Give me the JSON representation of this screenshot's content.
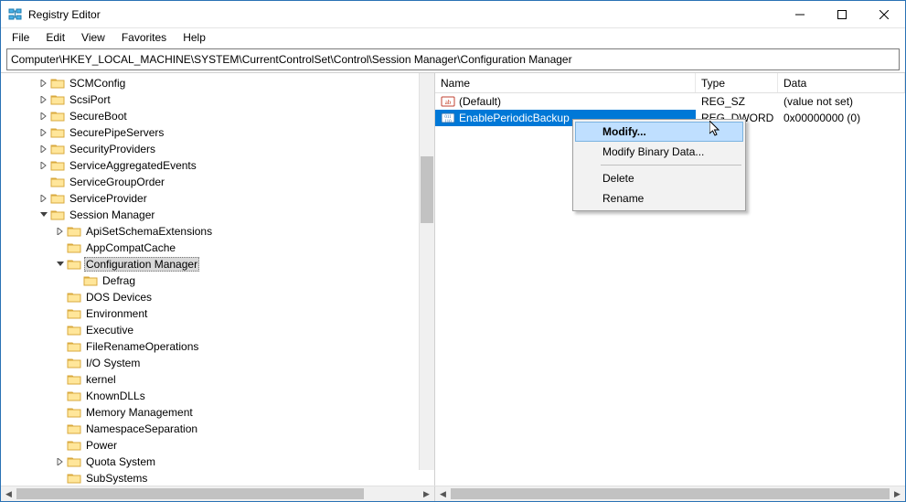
{
  "window": {
    "title": "Registry Editor"
  },
  "menu": {
    "file": "File",
    "edit": "Edit",
    "view": "View",
    "favorites": "Favorites",
    "help": "Help"
  },
  "addressbar": {
    "path": "Computer\\HKEY_LOCAL_MACHINE\\SYSTEM\\CurrentControlSet\\Control\\Session Manager\\Configuration Manager"
  },
  "tree": {
    "items": [
      {
        "indent": 2,
        "arrow": "right",
        "label": "SCMConfig"
      },
      {
        "indent": 2,
        "arrow": "right",
        "label": "ScsiPort"
      },
      {
        "indent": 2,
        "arrow": "right",
        "label": "SecureBoot"
      },
      {
        "indent": 2,
        "arrow": "right",
        "label": "SecurePipeServers"
      },
      {
        "indent": 2,
        "arrow": "right",
        "label": "SecurityProviders"
      },
      {
        "indent": 2,
        "arrow": "right",
        "label": "ServiceAggregatedEvents"
      },
      {
        "indent": 2,
        "arrow": "none",
        "label": "ServiceGroupOrder"
      },
      {
        "indent": 2,
        "arrow": "right",
        "label": "ServiceProvider"
      },
      {
        "indent": 2,
        "arrow": "down",
        "label": "Session Manager"
      },
      {
        "indent": 3,
        "arrow": "right",
        "label": "ApiSetSchemaExtensions"
      },
      {
        "indent": 3,
        "arrow": "none",
        "label": "AppCompatCache"
      },
      {
        "indent": 3,
        "arrow": "down",
        "label": "Configuration Manager",
        "selected": true
      },
      {
        "indent": 4,
        "arrow": "none",
        "label": "Defrag"
      },
      {
        "indent": 3,
        "arrow": "none",
        "label": "DOS Devices"
      },
      {
        "indent": 3,
        "arrow": "none",
        "label": "Environment"
      },
      {
        "indent": 3,
        "arrow": "none",
        "label": "Executive"
      },
      {
        "indent": 3,
        "arrow": "none",
        "label": "FileRenameOperations"
      },
      {
        "indent": 3,
        "arrow": "none",
        "label": "I/O System"
      },
      {
        "indent": 3,
        "arrow": "none",
        "label": "kernel"
      },
      {
        "indent": 3,
        "arrow": "none",
        "label": "KnownDLLs"
      },
      {
        "indent": 3,
        "arrow": "none",
        "label": "Memory Management"
      },
      {
        "indent": 3,
        "arrow": "none",
        "label": "NamespaceSeparation"
      },
      {
        "indent": 3,
        "arrow": "none",
        "label": "Power"
      },
      {
        "indent": 3,
        "arrow": "right",
        "label": "Quota System"
      },
      {
        "indent": 3,
        "arrow": "none",
        "label": "SubSystems"
      }
    ]
  },
  "list": {
    "columns": {
      "name": "Name",
      "type": "Type",
      "data": "Data"
    },
    "rows": [
      {
        "icon": "string",
        "name": "(Default)",
        "type": "REG_SZ",
        "data": "(value not set)",
        "selected": false
      },
      {
        "icon": "binary",
        "name": "EnablePeriodicBackup",
        "type": "REG_DWORD",
        "data": "0x00000000 (0)",
        "selected": true
      }
    ]
  },
  "contextmenu": {
    "items": [
      {
        "label": "Modify...",
        "hover": true
      },
      {
        "label": "Modify Binary Data..."
      },
      {
        "sep": true
      },
      {
        "label": "Delete"
      },
      {
        "label": "Rename"
      }
    ]
  }
}
